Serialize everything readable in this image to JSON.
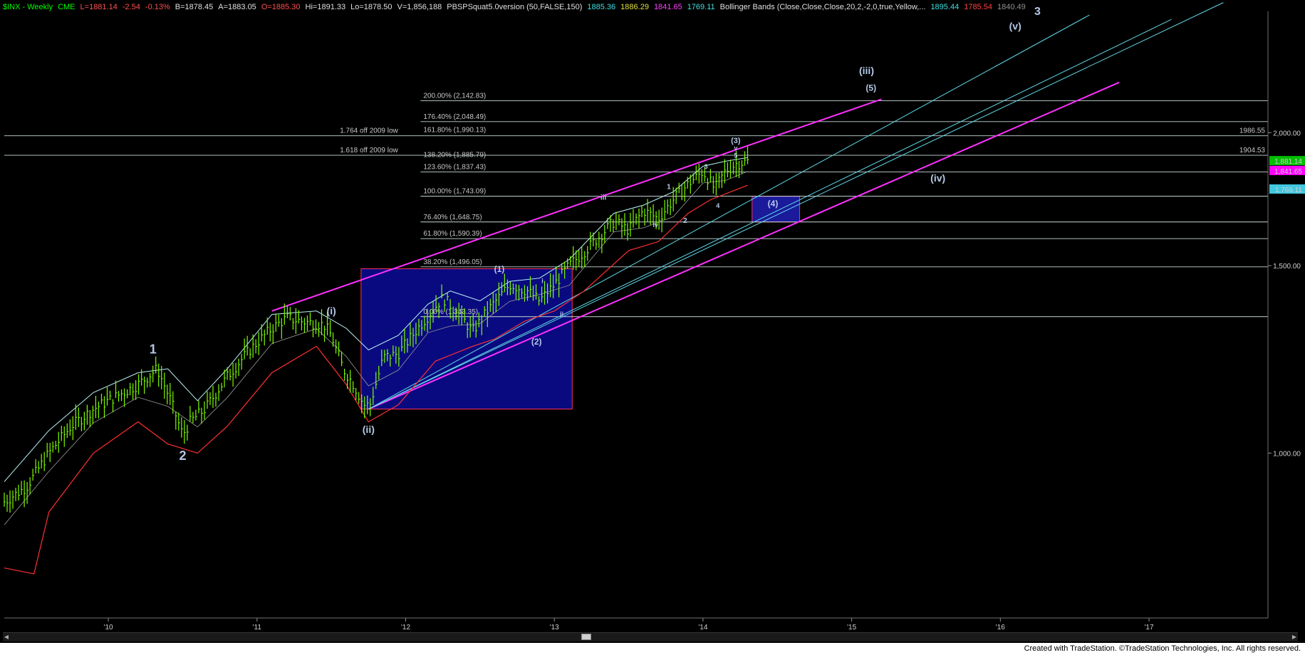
{
  "header": [
    {
      "text": "$INX - Weekly",
      "color": "#00ff00"
    },
    {
      "text": "CME",
      "color": "#00ff00"
    },
    {
      "text": "L=1881.14",
      "color": "#ff5050"
    },
    {
      "text": "-2.54",
      "color": "#ff5050"
    },
    {
      "text": "-0.13%",
      "color": "#ff5050"
    },
    {
      "text": "B=1878.45",
      "color": "#e0e0e0"
    },
    {
      "text": "A=1883.05",
      "color": "#e0e0e0"
    },
    {
      "text": "O=1885.30",
      "color": "#ff5050"
    },
    {
      "text": "Hi=1891.33",
      "color": "#e0e0e0"
    },
    {
      "text": "Lo=1878.50",
      "color": "#e0e0e0"
    },
    {
      "text": "V=1,856,188",
      "color": "#e0e0e0"
    },
    {
      "text": "PBSPSquat5.0version (50,FALSE,150)",
      "color": "#e0e0e0"
    },
    {
      "text": "1885.36",
      "color": "#40e0e0"
    },
    {
      "text": "1886.29",
      "color": "#e0e040"
    },
    {
      "text": "1841.65",
      "color": "#ff40ff"
    },
    {
      "text": "1769.11",
      "color": "#40e0e0"
    },
    {
      "text": "Bollinger Bands (Close,Close,Close,20,2,-2,0,true,Yellow,...",
      "color": "#e0e0e0"
    },
    {
      "text": "1895.44",
      "color": "#40e0e0"
    },
    {
      "text": "1785.54",
      "color": "#ff4040"
    },
    {
      "text": "1840.49",
      "color": "#909090"
    }
  ],
  "chart_data": {
    "type": "line",
    "subtype": "weekly-price-bars",
    "scale": "log",
    "ylim": [
      700,
      2600
    ],
    "xlim": [
      2009.3,
      2017.8
    ],
    "x_ticks": [
      {
        "label": "'10",
        "x": 2010.0
      },
      {
        "label": "'11",
        "x": 2011.0
      },
      {
        "label": "'12",
        "x": 2012.0
      },
      {
        "label": "'13",
        "x": 2013.0
      },
      {
        "label": "'14",
        "x": 2014.0
      },
      {
        "label": "'15",
        "x": 2015.0
      },
      {
        "label": "'16",
        "x": 2016.0
      },
      {
        "label": "'17",
        "x": 2017.0
      }
    ],
    "y_ticks": [
      {
        "label": "1,000.00",
        "value": 1000
      },
      {
        "label": "1,500.00",
        "value": 1500
      },
      {
        "label": "2,000.00",
        "value": 2000
      }
    ],
    "price_series": {
      "name": "$INX Weekly",
      "color": "#7cfc00",
      "points": [
        [
          2009.3,
          900
        ],
        [
          2009.45,
          930
        ],
        [
          2009.6,
          1000
        ],
        [
          2009.75,
          1060
        ],
        [
          2009.9,
          1100
        ],
        [
          2010.05,
          1130
        ],
        [
          2010.2,
          1160
        ],
        [
          2010.33,
          1200
        ],
        [
          2010.42,
          1120
        ],
        [
          2010.5,
          1040
        ],
        [
          2010.55,
          1070
        ],
        [
          2010.65,
          1100
        ],
        [
          2010.8,
          1180
        ],
        [
          2010.95,
          1250
        ],
        [
          2011.1,
          1310
        ],
        [
          2011.2,
          1340
        ],
        [
          2011.3,
          1330
        ],
        [
          2011.45,
          1320
        ],
        [
          2011.5,
          1290
        ],
        [
          2011.58,
          1200
        ],
        [
          2011.65,
          1160
        ],
        [
          2011.72,
          1110
        ],
        [
          2011.76,
          1110
        ],
        [
          2011.85,
          1230
        ],
        [
          2011.95,
          1240
        ],
        [
          2012.1,
          1320
        ],
        [
          2012.25,
          1400
        ],
        [
          2012.38,
          1340
        ],
        [
          2012.45,
          1300
        ],
        [
          2012.55,
          1360
        ],
        [
          2012.7,
          1440
        ],
        [
          2012.82,
          1420
        ],
        [
          2012.9,
          1390
        ],
        [
          2013.0,
          1440
        ],
        [
          2013.1,
          1500
        ],
        [
          2013.25,
          1570
        ],
        [
          2013.4,
          1650
        ],
        [
          2013.5,
          1620
        ],
        [
          2013.6,
          1690
        ],
        [
          2013.7,
          1660
        ],
        [
          2013.8,
          1730
        ],
        [
          2013.9,
          1790
        ],
        [
          2014.0,
          1840
        ],
        [
          2014.08,
          1770
        ],
        [
          2014.15,
          1840
        ],
        [
          2014.22,
          1870
        ],
        [
          2014.3,
          1880
        ]
      ]
    },
    "upper_band": {
      "color": "#b8f4f4",
      "points": [
        [
          2009.3,
          940
        ],
        [
          2009.6,
          1050
        ],
        [
          2009.9,
          1140
        ],
        [
          2010.2,
          1190
        ],
        [
          2010.4,
          1200
        ],
        [
          2010.6,
          1120
        ],
        [
          2010.8,
          1200
        ],
        [
          2011.1,
          1350
        ],
        [
          2011.4,
          1360
        ],
        [
          2011.6,
          1310
        ],
        [
          2011.75,
          1250
        ],
        [
          2011.95,
          1290
        ],
        [
          2012.15,
          1380
        ],
        [
          2012.3,
          1420
        ],
        [
          2012.5,
          1390
        ],
        [
          2012.7,
          1450
        ],
        [
          2012.9,
          1460
        ],
        [
          2013.1,
          1520
        ],
        [
          2013.4,
          1680
        ],
        [
          2013.6,
          1710
        ],
        [
          2013.8,
          1760
        ],
        [
          2014.0,
          1860
        ],
        [
          2014.15,
          1880
        ],
        [
          2014.3,
          1895
        ]
      ]
    },
    "lower_band": {
      "color": "#ff3030",
      "points": [
        [
          2009.3,
          780
        ],
        [
          2009.5,
          770
        ],
        [
          2009.6,
          880
        ],
        [
          2009.9,
          1000
        ],
        [
          2010.2,
          1070
        ],
        [
          2010.4,
          1020
        ],
        [
          2010.6,
          1000
        ],
        [
          2010.8,
          1060
        ],
        [
          2011.1,
          1190
        ],
        [
          2011.4,
          1260
        ],
        [
          2011.6,
          1160
        ],
        [
          2011.75,
          1070
        ],
        [
          2011.95,
          1110
        ],
        [
          2012.2,
          1220
        ],
        [
          2012.45,
          1260
        ],
        [
          2012.6,
          1280
        ],
        [
          2012.8,
          1330
        ],
        [
          2013.0,
          1360
        ],
        [
          2013.2,
          1420
        ],
        [
          2013.5,
          1550
        ],
        [
          2013.7,
          1580
        ],
        [
          2013.9,
          1680
        ],
        [
          2014.05,
          1730
        ],
        [
          2014.3,
          1785
        ]
      ]
    },
    "horizontal_levels": [
      {
        "value": 2142.83,
        "label": "200.00% (2,142.83)",
        "x_start": 2012.1,
        "label_color": "#c8c8c8"
      },
      {
        "value": 2048.49,
        "label": "176.40% (2,048.49)",
        "x_start": 2012.1,
        "label_color": "#c8c8c8"
      },
      {
        "value": 1986.55,
        "label": "1.764 off 2009 low",
        "right_label": "1986.55",
        "x_start": 2009.3,
        "label_color": "#c8c8c8"
      },
      {
        "value": 1990.13,
        "label": "161.80% (1,990.13)",
        "x_start": 2012.1,
        "label_color": "#c8c860",
        "nodraw": true
      },
      {
        "value": 1904.53,
        "label": "1.618 off 2009 low",
        "right_label": "1904.53",
        "x_start": 2009.3,
        "label_color": "#c8c8c8"
      },
      {
        "value": 1885.79,
        "label": "138.20% (1,885.79)",
        "x_start": 2012.1,
        "label_color": "#40c0c0",
        "nodraw": true
      },
      {
        "value": 1837.43,
        "label": "123.60% (1,837.43)",
        "x_start": 2012.1,
        "label_color": "#c8c8c8"
      },
      {
        "value": 1743.09,
        "label": "100.00% (1,743.09)",
        "x_start": 2012.1,
        "label_color": "#c8c8c8"
      },
      {
        "value": 1648.75,
        "label": "76.40% (1,648.75)",
        "x_start": 2012.1,
        "label_color": "#c8c8c8"
      },
      {
        "value": 1590.39,
        "label": "61.80% (1,590.39)",
        "x_start": 2012.1,
        "label_color": "#c8c860"
      },
      {
        "value": 1496.05,
        "label": "38.20% (1,496.05)",
        "x_start": 2012.1,
        "label_color": "#40c0c0"
      },
      {
        "value": 1343.35,
        "label": "0.00% (1,343.35)",
        "x_start": 2012.1,
        "label_color": "#c8c860"
      }
    ],
    "right_tags": [
      {
        "text": "1,881.14",
        "value": 1881.14,
        "bg": "#00c000",
        "fg": "#ffffff"
      },
      {
        "text": "1,841.65",
        "value": 1841.65,
        "bg": "#ff00ff",
        "fg": "#ffffff"
      },
      {
        "text": "1,769.11",
        "value": 1769.11,
        "bg": "#40c8e0",
        "fg": "#000000"
      }
    ],
    "channels": [
      {
        "color": "#ff30ff",
        "width": 2,
        "points": [
          [
            2011.1,
            1360
          ],
          [
            2015.2,
            2150
          ]
        ]
      },
      {
        "color": "#ff30ff",
        "width": 2,
        "points": [
          [
            2011.75,
            1100
          ],
          [
            2016.8,
            2230
          ]
        ]
      },
      {
        "color": "#60d8e8",
        "width": 1,
        "points": [
          [
            2011.75,
            1100
          ],
          [
            2017.5,
            2650
          ]
        ]
      },
      {
        "color": "#60d8e8",
        "width": 1,
        "points": [
          [
            2011.75,
            1100
          ],
          [
            2017.15,
            2555
          ]
        ]
      },
      {
        "color": "#60d8e8",
        "width": 1,
        "points": [
          [
            2011.75,
            1100
          ],
          [
            2016.6,
            2580
          ]
        ]
      }
    ],
    "boxes": [
      {
        "x0": 2011.7,
        "x1": 2013.12,
        "y0": 1100,
        "y1": 1490,
        "fill": "#0a0a80",
        "stroke": "#ff3060"
      },
      {
        "x0": 2014.33,
        "x1": 2014.65,
        "y0": 1648.75,
        "y1": 1743.09,
        "fill": "#1a1a9a",
        "stroke": "#ff3060"
      }
    ],
    "annotations": [
      {
        "text": "3",
        "x": 2016.25,
        "value": 2580,
        "size": 16
      },
      {
        "text": "(v)",
        "x": 2016.1,
        "value": 2500,
        "size": 14
      },
      {
        "text": "(iii)",
        "x": 2015.1,
        "value": 2270,
        "size": 14
      },
      {
        "text": "(5)",
        "x": 2015.13,
        "value": 2190,
        "size": 12
      },
      {
        "text": "(3)",
        "x": 2014.22,
        "value": 1955,
        "size": 11
      },
      {
        "text": "v",
        "x": 2014.22,
        "value": 1925,
        "size": 9
      },
      {
        "text": "5",
        "x": 2014.22,
        "value": 1895,
        "size": 9
      },
      {
        "text": "3",
        "x": 2014.02,
        "value": 1850,
        "size": 9
      },
      {
        "text": "1",
        "x": 2013.77,
        "value": 1770,
        "size": 10
      },
      {
        "text": "iii",
        "x": 2013.33,
        "value": 1730,
        "size": 10
      },
      {
        "text": "4",
        "x": 2014.1,
        "value": 1700,
        "size": 9
      },
      {
        "text": "2",
        "x": 2013.88,
        "value": 1645,
        "size": 10
      },
      {
        "text": "iv",
        "x": 2013.68,
        "value": 1630,
        "size": 9
      },
      {
        "text": "(iv)",
        "x": 2015.58,
        "value": 1800,
        "size": 14
      },
      {
        "text": "(4)",
        "x": 2014.47,
        "value": 1705,
        "size": 12
      },
      {
        "text": "(1)",
        "x": 2012.63,
        "value": 1480,
        "size": 12
      },
      {
        "text": "i",
        "x": 2012.92,
        "value": 1445,
        "size": 9
      },
      {
        "text": "ii",
        "x": 2013.05,
        "value": 1345,
        "size": 9
      },
      {
        "text": "(2)",
        "x": 2012.88,
        "value": 1265,
        "size": 12
      },
      {
        "text": "(i)",
        "x": 2011.5,
        "value": 1350,
        "size": 14
      },
      {
        "text": "(ii)",
        "x": 2011.75,
        "value": 1045,
        "size": 14
      },
      {
        "text": "1",
        "x": 2010.3,
        "value": 1240,
        "size": 18
      },
      {
        "text": "2",
        "x": 2010.5,
        "value": 985,
        "size": 18
      }
    ]
  },
  "footer": "Created with TradeStation. ©TradeStation Technologies, Inc. All rights reserved."
}
